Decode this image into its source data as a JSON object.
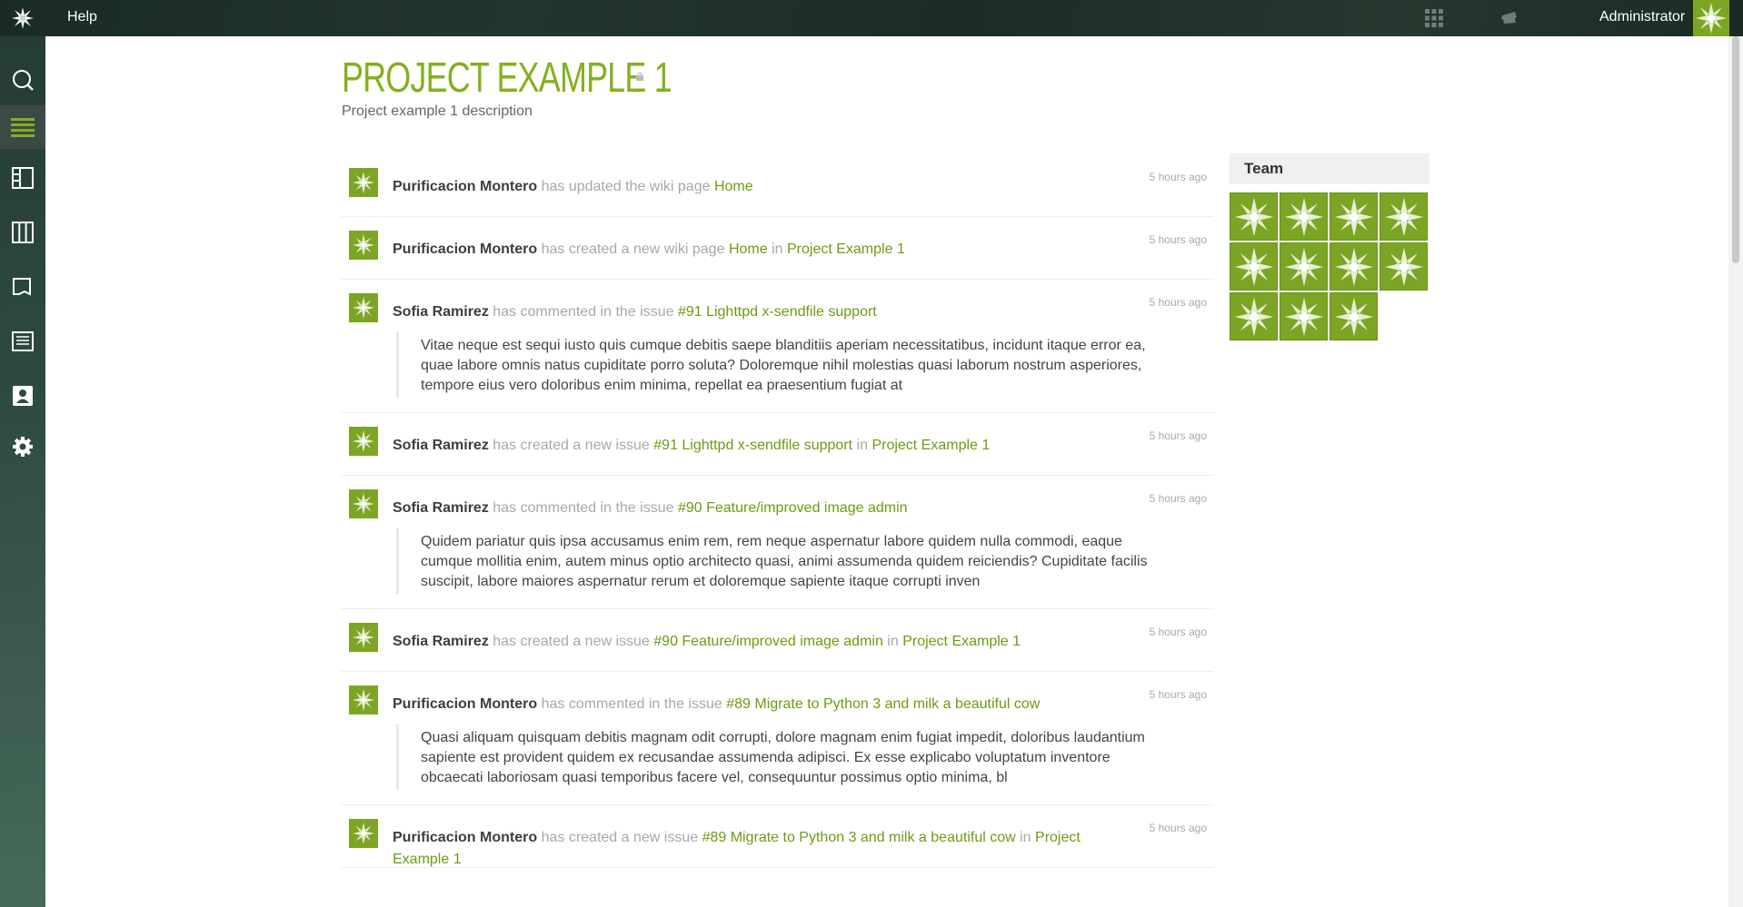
{
  "topbar": {
    "logo_icon": "taiga-logo-icon",
    "help_label": "Help",
    "user_name": "Administrator"
  },
  "sidebar": {
    "items": [
      {
        "name": "search",
        "icon": "search-icon"
      },
      {
        "name": "timeline",
        "icon": "timeline-icon",
        "active": true
      },
      {
        "name": "backlog",
        "icon": "backlog-icon"
      },
      {
        "name": "kanban",
        "icon": "kanban-icon"
      },
      {
        "name": "issues",
        "icon": "issues-icon"
      },
      {
        "name": "wiki",
        "icon": "wiki-icon"
      },
      {
        "name": "team",
        "icon": "team-icon"
      },
      {
        "name": "admin",
        "icon": "gear-icon"
      }
    ]
  },
  "project": {
    "title": "PROJECT EXAMPLE 1",
    "description": "Project example 1 description"
  },
  "timeline": [
    {
      "user": "Purificacion Montero",
      "action": "has updated the wiki page",
      "target": "Home",
      "in_text": "",
      "project": "",
      "time": "5 hours ago",
      "comment": ""
    },
    {
      "user": "Purificacion Montero",
      "action": "has created a new wiki page",
      "target": "Home",
      "in_text": "in",
      "project": "Project Example 1",
      "time": "5 hours ago",
      "comment": ""
    },
    {
      "user": "Sofia Ramirez",
      "action": "has commented in the issue",
      "target": "#91 Lighttpd x-sendfile support",
      "in_text": "",
      "project": "",
      "time": "5 hours ago",
      "comment": "Vitae neque est sequi iusto quis cumque debitis saepe blanditiis aperiam necessitatibus, incidunt itaque error ea, quae labore omnis natus cupiditate porro soluta? Doloremque nihil molestias quasi laborum nostrum asperiores, tempore eius vero doloribus enim minima, repellat ea praesentium fugiat at"
    },
    {
      "user": "Sofia Ramirez",
      "action": "has created a new issue",
      "target": "#91 Lighttpd x-sendfile support",
      "in_text": "in",
      "project": "Project Example 1",
      "time": "5 hours ago",
      "comment": ""
    },
    {
      "user": "Sofia Ramirez",
      "action": "has commented in the issue",
      "target": "#90 Feature/improved image admin",
      "in_text": "",
      "project": "",
      "time": "5 hours ago",
      "comment": "Quidem pariatur quis ipsa accusamus enim rem, rem neque aspernatur labore quidem nulla commodi, eaque cumque mollitia enim, autem minus optio architecto quasi, animi assumenda quidem reiciendis? Cupiditate facilis suscipit, labore maiores aspernatur rerum et doloremque sapiente itaque corrupti inven"
    },
    {
      "user": "Sofia Ramirez",
      "action": "has created a new issue",
      "target": "#90 Feature/improved image admin",
      "in_text": "in",
      "project": "Project Example 1",
      "time": "5 hours ago",
      "comment": ""
    },
    {
      "user": "Purificacion Montero",
      "action": "has commented in the issue",
      "target": "#89 Migrate to Python 3 and milk a beautiful cow",
      "in_text": "",
      "project": "",
      "time": "5 hours ago",
      "comment": "Quasi aliquam quisquam debitis magnam odit corrupti, dolore magnam enim fugiat impedit, doloribus laudantium sapiente est provident quidem ex recusandae assumenda adipisci. Ex esse explicabo voluptatum inventore obcaecati laboriosam quasi temporibus facere vel, consequuntur possimus optio minima, bl"
    },
    {
      "user": "Purificacion Montero",
      "action": "has created a new issue",
      "target": "#89 Migrate to Python 3 and milk a beautiful cow",
      "in_text": "in",
      "project": "Project Example 1",
      "time": "5 hours ago",
      "comment": ""
    }
  ],
  "team": {
    "title": "Team",
    "member_count": 11
  },
  "colors": {
    "accent": "#83b01f",
    "link": "#6e9a12",
    "avatar": "#7da525"
  }
}
